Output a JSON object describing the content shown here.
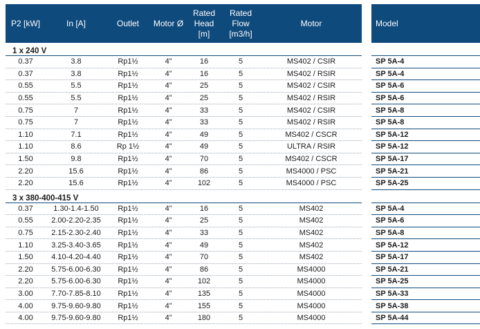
{
  "headers": {
    "p2": "P2 [kW]",
    "in": "In [A]",
    "outlet": "Outlet",
    "motor_d": "Motor Ø",
    "head_l1": "Rated",
    "head_l2": "Head",
    "head_l3": "[m]",
    "flow_l1": "Rated",
    "flow_l2": "Flow",
    "flow_l3": "[m3/h]",
    "motor": "Motor",
    "model": "Model"
  },
  "group1": {
    "label": "1  x 240 V",
    "rows": [
      {
        "p2": "0.37",
        "in": "3.8",
        "outlet": "Rp1½",
        "motor_d": "4”",
        "head": "16",
        "flow": "5",
        "motor": "MS402 / CSIR",
        "model": "SP 5A-4"
      },
      {
        "p2": "0.37",
        "in": "3.8",
        "outlet": "Rp1½",
        "motor_d": "4”",
        "head": "16",
        "flow": "5",
        "motor": "MS402 / RSIR",
        "model": "SP 5A-4"
      },
      {
        "p2": "0.55",
        "in": "5.5",
        "outlet": "Rp1½",
        "motor_d": "4”",
        "head": "25",
        "flow": "5",
        "motor": "MS402 / CSIR",
        "model": "SP 5A-6"
      },
      {
        "p2": "0.55",
        "in": "5.5",
        "outlet": "Rp1½",
        "motor_d": "4”",
        "head": "25",
        "flow": "5",
        "motor": "MS402 / RSIR",
        "model": "SP 5A-6"
      },
      {
        "p2": "0.75",
        "in": "7",
        "outlet": "Rp1½",
        "motor_d": "4”",
        "head": "33",
        "flow": "5",
        "motor": "MS402 / CSIR",
        "model": "SP 5A-8"
      },
      {
        "p2": "0.75",
        "in": "7",
        "outlet": "Rp1½",
        "motor_d": "4”",
        "head": "33",
        "flow": "5",
        "motor": "MS402 / RSIR",
        "model": "SP 5A-8"
      },
      {
        "p2": "1.10",
        "in": "7.1",
        "outlet": "Rp1½",
        "motor_d": "4”",
        "head": "49",
        "flow": "5",
        "motor": "MS402 / CSCR",
        "model": "SP 5A-12"
      },
      {
        "p2": "1.10",
        "in": "8.6",
        "outlet": "Rp 1½",
        "motor_d": "4”",
        "head": "49",
        "flow": "5",
        "motor": "ULTRA / RSIR",
        "model": "SP 5A-12"
      },
      {
        "p2": "1.50",
        "in": "9.8",
        "outlet": "Rp1½",
        "motor_d": "4”",
        "head": "70",
        "flow": "5",
        "motor": "MS402 / CSCR",
        "model": "SP 5A-17"
      },
      {
        "p2": "2.20",
        "in": "15.6",
        "outlet": "Rp1½",
        "motor_d": "4”",
        "head": "86",
        "flow": "5",
        "motor": "MS4000 / PSC",
        "model": "SP 5A-21"
      },
      {
        "p2": "2.20",
        "in": "15.6",
        "outlet": "Rp1½",
        "motor_d": "4”",
        "head": "102",
        "flow": "5",
        "motor": "MS4000 / PSC",
        "model": "SP 5A-25"
      }
    ]
  },
  "group2": {
    "label": "3  x 380-400-415 V",
    "rows": [
      {
        "p2": "0.37",
        "in": "1.30-1.4-1.50",
        "outlet": "Rp1½",
        "motor_d": "4”",
        "head": "16",
        "flow": "5",
        "motor": "MS402",
        "model": "SP 5A-4"
      },
      {
        "p2": "0.55",
        "in": "2.00-2.20-2.35",
        "outlet": "Rp1½",
        "motor_d": "4”",
        "head": "25",
        "flow": "5",
        "motor": "MS402",
        "model": "SP 5A-6"
      },
      {
        "p2": "0.75",
        "in": "2.15-2.30-2.40",
        "outlet": "Rp1½",
        "motor_d": "4”",
        "head": "33",
        "flow": "5",
        "motor": "MS402",
        "model": "SP 5A-8"
      },
      {
        "p2": "1.10",
        "in": "3.25-3.40-3.65",
        "outlet": "Rp1½",
        "motor_d": "4”",
        "head": "49",
        "flow": "5",
        "motor": "MS402",
        "model": "SP 5A-12"
      },
      {
        "p2": "1.50",
        "in": "4.10-4.20-4.40",
        "outlet": "Rp1½",
        "motor_d": "4”",
        "head": "70",
        "flow": "5",
        "motor": "MS402",
        "model": "SP 5A-17"
      },
      {
        "p2": "2.20",
        "in": "5.75-6.00-6.30",
        "outlet": "Rp1½",
        "motor_d": "4”",
        "head": "86",
        "flow": "5",
        "motor": "MS4000",
        "model": "SP 5A-21"
      },
      {
        "p2": "2.20",
        "in": "5.75-6.00-6.30",
        "outlet": "Rp1½",
        "motor_d": "4”",
        "head": "102",
        "flow": "5",
        "motor": "MS4000",
        "model": "SP 5A-25"
      },
      {
        "p2": "3.00",
        "in": "7.70-7.85-8.10",
        "outlet": "Rp1½",
        "motor_d": "4”",
        "head": "135",
        "flow": "5",
        "motor": "MS4000",
        "model": "SP 5A-33"
      },
      {
        "p2": "4.00",
        "in": "9.75-9.60-9.80",
        "outlet": "Rp1½",
        "motor_d": "4”",
        "head": "155",
        "flow": "5",
        "motor": "MS4000",
        "model": "SP 5A-38"
      },
      {
        "p2": "4.00",
        "in": "9.75-9.60-9.80",
        "outlet": "Rp1½",
        "motor_d": "4”",
        "head": "180",
        "flow": "5",
        "motor": "MS4000",
        "model": "SP 5A-44"
      }
    ]
  },
  "colors": {
    "header_bg": "#0f4a7c",
    "header_text": "#ffffff"
  }
}
